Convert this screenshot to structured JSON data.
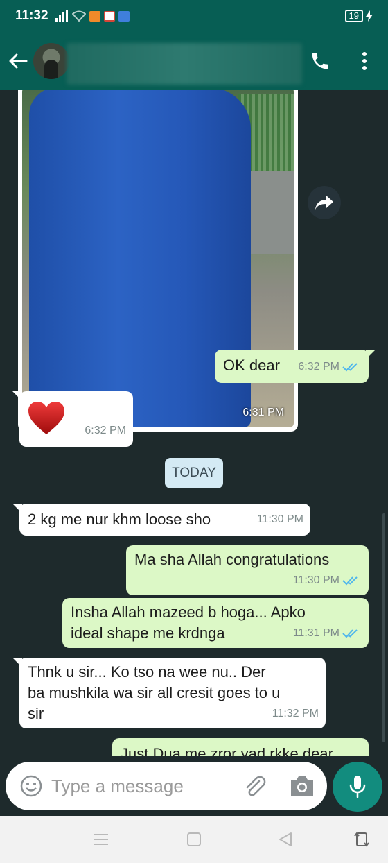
{
  "status_bar": {
    "time": "11:32",
    "battery": "19"
  },
  "photo_message": {
    "time": "6:31 PM"
  },
  "messages": [
    {
      "dir": "out",
      "lines": [
        "OK dear"
      ],
      "time": "6:32 PM",
      "ticks": true
    },
    {
      "dir": "in",
      "emoji": "heart",
      "time": "6:32 PM"
    },
    {
      "dir": "in",
      "lines": [
        "2 kg me nur khm loose sho"
      ],
      "time": "11:30 PM"
    },
    {
      "dir": "out",
      "lines": [
        "Ma sha Allah congratulations"
      ],
      "time": "11:30 PM",
      "ticks": true
    },
    {
      "dir": "out",
      "lines": [
        "Insha Allah mazeed b hoga... Apko",
        "ideal shape me krdnga"
      ],
      "time": "11:31 PM",
      "ticks": true
    },
    {
      "dir": "in",
      "lines": [
        "Thnk u sir...  Ko tso na wee nu..  Der",
        "ba mushkila wa sir all cresit goes to u",
        "sir"
      ],
      "time": "11:32 PM"
    },
    {
      "dir": "out",
      "lines": [
        "Just Dua me zror yad rkke dear"
      ]
    }
  ],
  "date_chip": "TODAY",
  "input": {
    "placeholder": "Type a message"
  },
  "colors": {
    "header": "#075e54",
    "outgoing": "#dcf8c6",
    "incoming": "#ffffff",
    "background": "#1e2a2c",
    "mic": "#128c7e",
    "ticks": "#4fb6ec"
  },
  "icons": [
    "back-arrow-icon",
    "phone-icon",
    "more-vert-icon",
    "forward-icon",
    "emoji-icon",
    "attach-icon",
    "camera-icon",
    "mic-icon"
  ]
}
